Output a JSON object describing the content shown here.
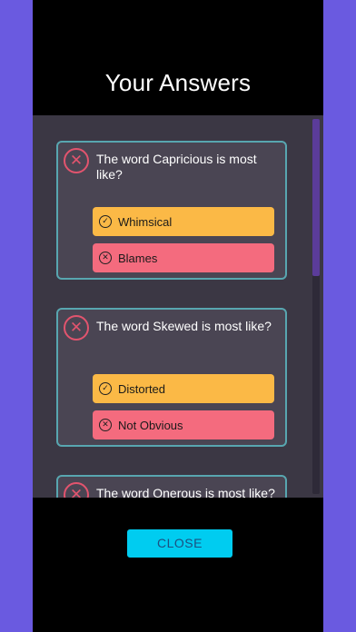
{
  "header": {
    "title": "Your Answers"
  },
  "questions": [
    {
      "question": "The word Capricious is most like?",
      "status_icon": "x-circle-icon",
      "correct_answer": "Whimsical",
      "your_answer": "Blames"
    },
    {
      "question": "The word Skewed is most like?",
      "status_icon": "x-circle-icon",
      "correct_answer": "Distorted",
      "your_answer": "Not Obvious"
    },
    {
      "question": "The word Onerous is most like?",
      "status_icon": "x-circle-icon"
    }
  ],
  "icons": {
    "status_wrong": "✕",
    "check": "✓",
    "cross": "✕"
  },
  "footer": {
    "close_label": "CLOSE"
  },
  "colors": {
    "background": "#6a5ae0",
    "correct": "#fbb946",
    "wrong": "#f46b7e",
    "card_border": "#58a6b0",
    "close_button": "#00ccf0"
  }
}
